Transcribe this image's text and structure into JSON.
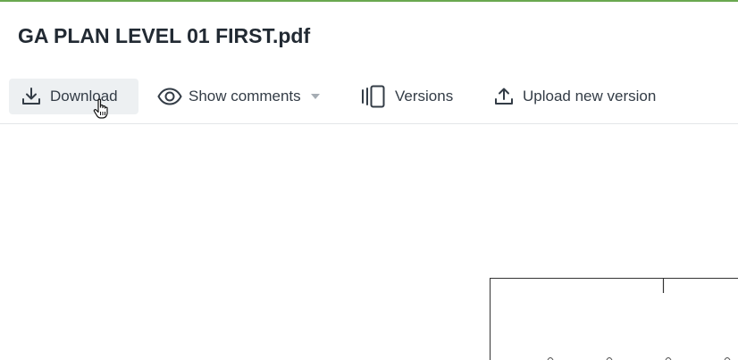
{
  "document": {
    "title": "GA PLAN LEVEL 01 FIRST.pdf"
  },
  "toolbar": {
    "download_label": "Download",
    "show_comments_label": "Show comments",
    "versions_label": "Versions",
    "upload_label": "Upload new version"
  },
  "icons": {
    "download": "download-icon",
    "show_comments": "eye-icon",
    "show_comments_caret": "caret-down-icon",
    "versions": "versions-icon",
    "upload": "upload-icon",
    "cursor": "hand-pointer-cursor"
  },
  "colors": {
    "accent": "#6aa84f",
    "button_active_bg": "#edf0f2",
    "text": "#333c46"
  }
}
